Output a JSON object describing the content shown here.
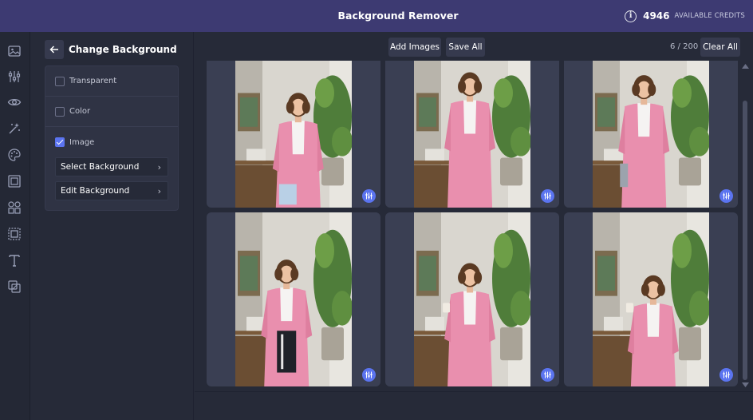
{
  "app": {
    "title": "Background Remover"
  },
  "credits": {
    "count": "4946",
    "label": "AVAILABLE CREDITS",
    "icon": "info-icon"
  },
  "rail": {
    "icons": [
      "image-icon",
      "adjustments-icon",
      "eye-icon",
      "magic-icon",
      "palette-icon",
      "frame-icon",
      "shapes-icon",
      "crop-icon",
      "text-icon",
      "layers-icon"
    ]
  },
  "panel": {
    "title": "Change Background",
    "back_icon": "arrow-left-icon",
    "options": [
      {
        "label": "Transparent",
        "checked": false
      },
      {
        "label": "Color",
        "checked": false
      },
      {
        "label": "Image",
        "checked": true
      }
    ],
    "select_background": "Select Background",
    "edit_background": "Edit Background"
  },
  "toolbar": {
    "add_images": "Add Images",
    "save_all": "Save All",
    "count": "6 / 200",
    "clear_all": "Clear All"
  },
  "colors": {
    "accent": "#5b74f0",
    "topbar": "#3d3a72",
    "background": "#262a38",
    "card": "#3a3f53"
  }
}
